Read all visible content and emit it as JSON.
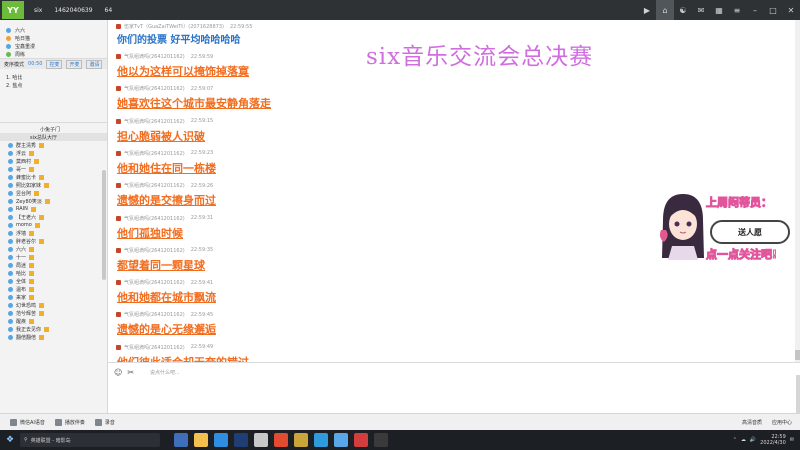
{
  "topbar": {
    "app_name": "six",
    "room_id": "1462040639",
    "online_count": "64"
  },
  "overlay_title": "six音乐交流会总决赛",
  "left_panel": {
    "channels": [
      "六六",
      "哈日猫",
      "宝鑫重漫",
      "周练"
    ],
    "mode_label": "麦序模式",
    "mode_time": "00:50",
    "mode_buttons": [
      "控麦",
      "开麦",
      "邀请"
    ],
    "queue": [
      "1. 哈比",
      "2. 盐点"
    ],
    "room_label": "小兔子门",
    "banner": "six总队大厅",
    "users": [
      "群主清秀",
      "浮云",
      "莫西村",
      "哥一",
      "蜂蜜比卡",
      "照比如家妹",
      "昱台阿",
      "Zey80笑淡",
      "RAIN",
      "【王老六",
      "momo",
      "浮墙",
      "胖老谷尔",
      "六六",
      "十一",
      "局迷",
      "哈比",
      "全体",
      "温布",
      "来家",
      "幻世恐鸣",
      "范兮辉苦",
      "醒疾",
      "我正去见你",
      "翻倍翻倍"
    ]
  },
  "chat": {
    "first_sender": "伍家TvT（GuaZaiTWeiTt）(2071628873)",
    "first_time": "22:59:55",
    "first_text": "你们的投票 好平均哈哈哈哈",
    "sender": "气氛组滴吗(2641201162)",
    "messages": [
      {
        "time": "22:59:59",
        "text": "他以为这样可以掩饰掉落寞"
      },
      {
        "time": "22:59:07",
        "text": "她喜欢往这个城市最安静角落走"
      },
      {
        "time": "22:59:15",
        "text": "担心脆弱被人识破"
      },
      {
        "time": "22:59:23",
        "text": "他和她住在同一栋楼"
      },
      {
        "time": "22:59:26",
        "text": "遗憾的是交擦身而过"
      },
      {
        "time": "22:59:31",
        "text": "他们孤独时候"
      },
      {
        "time": "22:59:35",
        "text": "都望着同一颗星球"
      },
      {
        "time": "22:59:41",
        "text": "他和她都在城市飘流"
      },
      {
        "time": "22:59:45",
        "text": "遗憾的是心无缘邂逅"
      },
      {
        "time": "22:59:49",
        "text": "他们彼此适合却无奈的错过"
      }
    ]
  },
  "girl": {
    "top_text": "上周闷蒂员：",
    "bubble_text": "送人愿",
    "bottom_text": "点一点关注吧!"
  },
  "input": {
    "placeholder": "说点什么吧..."
  },
  "appbar": {
    "items": [
      "微信AI语音",
      "播放伴奏",
      "录音"
    ],
    "right_items": [
      "高清音质",
      "应用中心"
    ]
  },
  "taskbar": {
    "search_text": "英雄联盟 - 暗影岛",
    "time": "22:59",
    "date": "2022/4/30"
  }
}
